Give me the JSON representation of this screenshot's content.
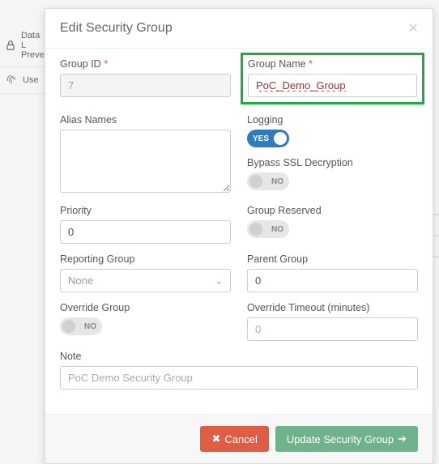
{
  "modal": {
    "title": "Edit Security Group",
    "groupId": {
      "label": "Group ID",
      "value": "7"
    },
    "groupName": {
      "label": "Group Name",
      "value": "PoC_Demo_Group"
    },
    "aliasNames": {
      "label": "Alias Names",
      "value": ""
    },
    "logging": {
      "label": "Logging",
      "state": "YES"
    },
    "bypassSsl": {
      "label": "Bypass SSL Decryption",
      "state": "NO"
    },
    "priority": {
      "label": "Priority",
      "value": "0"
    },
    "groupReserved": {
      "label": "Group Reserved",
      "state": "NO"
    },
    "reportingGroup": {
      "label": "Reporting Group",
      "value": "None"
    },
    "parentGroup": {
      "label": "Parent Group",
      "value": "0"
    },
    "overrideGroup": {
      "label": "Override Group",
      "state": "NO"
    },
    "overrideTimeout": {
      "label": "Override Timeout (minutes)",
      "value": "0"
    },
    "note": {
      "label": "Note",
      "placeholder": "PoC Demo Security Group"
    },
    "requiredMark": "*",
    "actions": {
      "cancel": "Cancel",
      "submit": "Update Security Group"
    }
  },
  "background": {
    "item1": "Data L",
    "item1b": "Preve",
    "item2": "Use"
  }
}
